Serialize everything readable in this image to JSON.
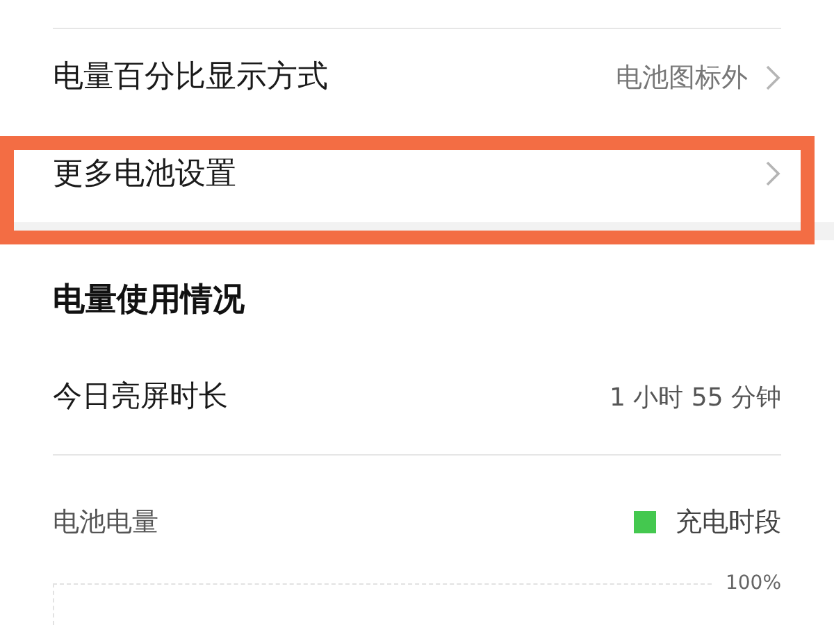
{
  "settings_rows": [
    {
      "label": "电量百分比显示方式",
      "value": "电池图标外",
      "highlighted": false
    },
    {
      "label": "更多电池设置",
      "highlighted": true
    }
  ],
  "usage_section": {
    "title": "电量使用情况",
    "screen_time": {
      "label": "今日亮屏时长",
      "value": "1 小时 55 分钟"
    },
    "battery_chart": {
      "title": "电池电量",
      "legend": [
        {
          "label": "充电时段",
          "color": "#44c84f"
        }
      ],
      "y_label": "100%"
    }
  }
}
